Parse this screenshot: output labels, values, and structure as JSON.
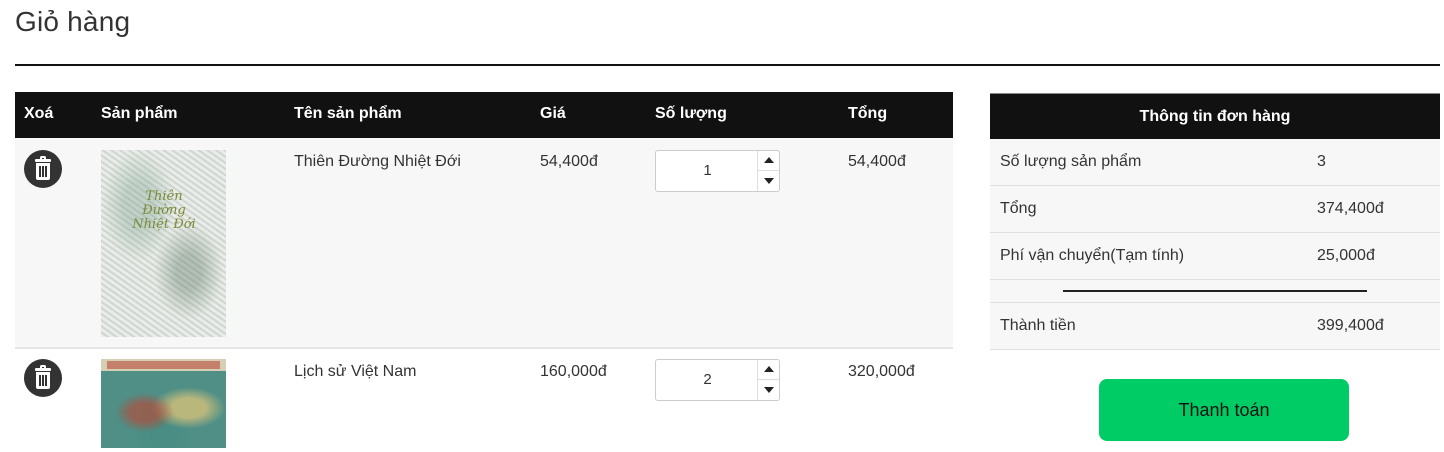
{
  "page": {
    "title": "Giỏ hàng"
  },
  "cart": {
    "headers": {
      "delete": "Xoá",
      "product": "Sản phẩm",
      "name": "Tên sản phẩm",
      "price": "Giá",
      "quantity": "Số lượng",
      "total": "Tổng"
    },
    "items": [
      {
        "name": "Thiên Đường Nhiệt Đới",
        "price": "54,400đ",
        "quantity": "1",
        "total": "54,400đ",
        "cover_title": "Thiên Đường Nhiệt Đới"
      },
      {
        "name": "Lịch sử Việt Nam",
        "price": "160,000đ",
        "quantity": "2",
        "total": "320,000đ"
      }
    ]
  },
  "summary": {
    "title": "Thông tin đơn hàng",
    "rows": [
      {
        "label": "Số lượng sản phẩm",
        "value": "3"
      },
      {
        "label": "Tổng",
        "value": "374,400đ"
      },
      {
        "label": "Phí vận chuyển(Tạm tính)",
        "value": "25,000đ"
      }
    ],
    "grand_total": {
      "label": "Thành tiền",
      "value": "399,400đ"
    },
    "checkout_label": "Thanh toán"
  },
  "colors": {
    "header_bg": "#111111",
    "row_bg": "#f7f7f7",
    "checkout_bg": "#00cc66"
  },
  "icons": {
    "delete": "trash-icon",
    "spin_up": "caret-up-icon",
    "spin_down": "caret-down-icon"
  }
}
